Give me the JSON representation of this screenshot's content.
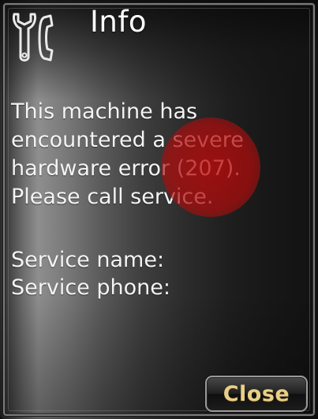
{
  "dialog": {
    "title": "Info",
    "header_icon": "wrench-phone-icon",
    "message_lines": [
      "This machine has",
      "encountered a severe",
      "hardware error (207).",
      "Please call service."
    ],
    "service": {
      "name_label": "Service name:",
      "name_value": "",
      "phone_label": "Service phone:",
      "phone_value": ""
    },
    "close_label": "Close"
  },
  "colors": {
    "accent_text": "#e8cf88",
    "touch_marker": "#c0141a",
    "text": "#f4f4f4"
  }
}
